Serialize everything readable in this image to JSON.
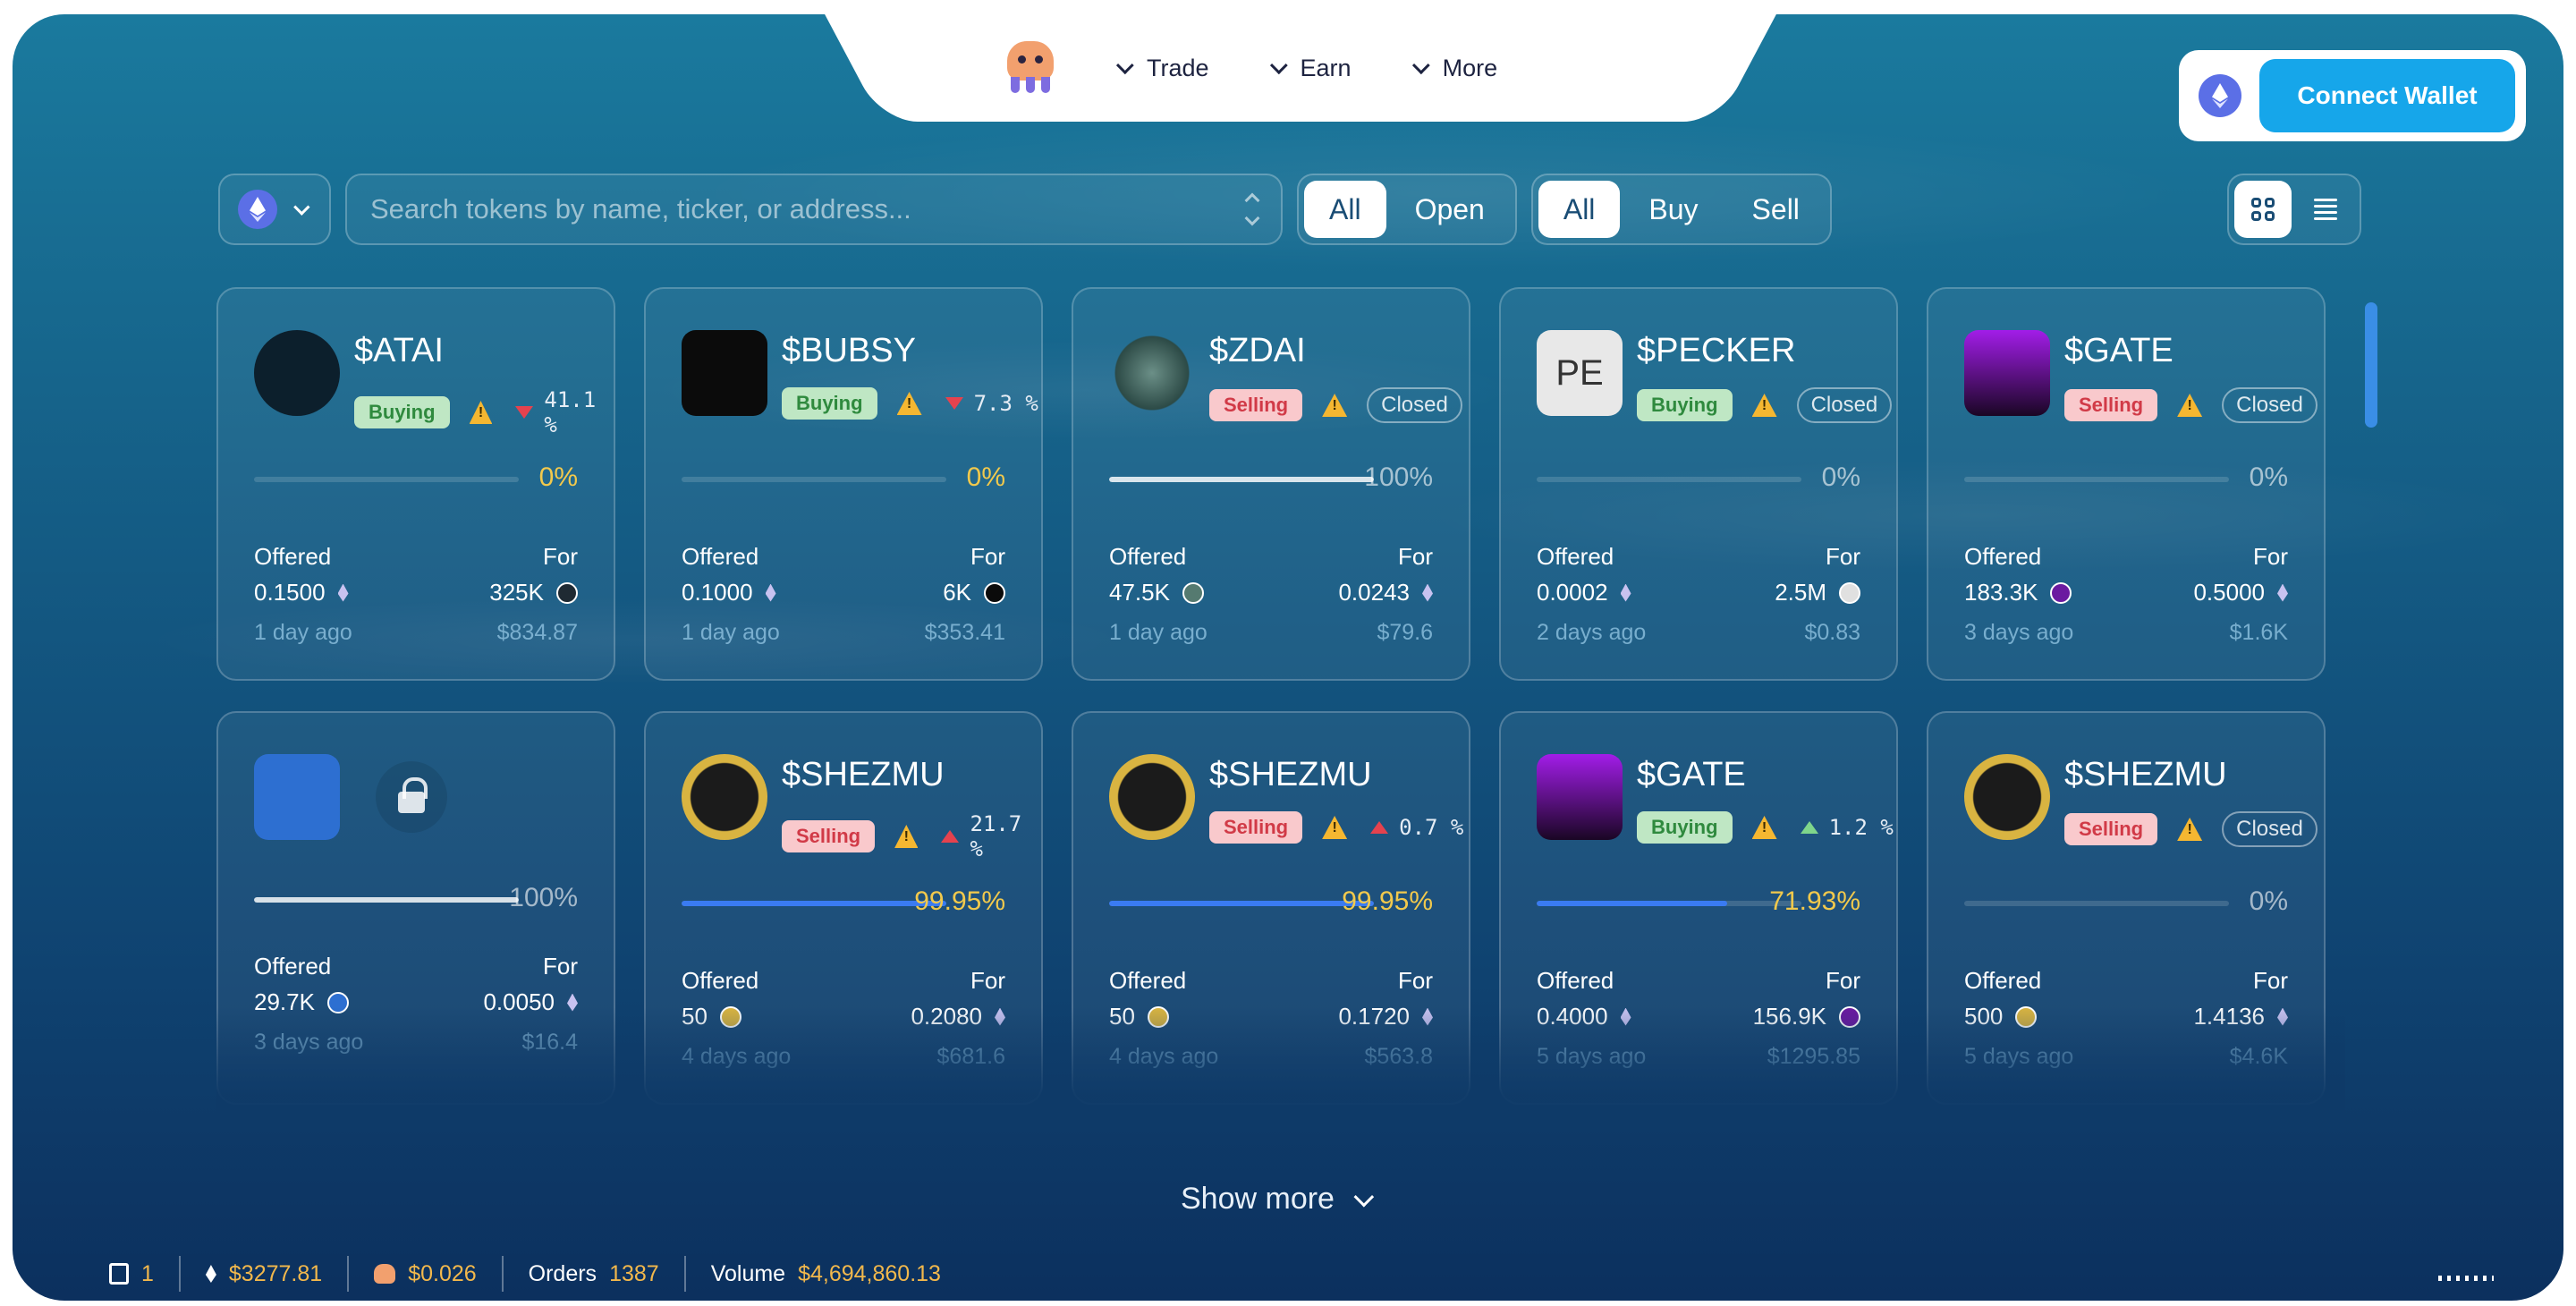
{
  "nav": {
    "items": [
      {
        "label": "Trade"
      },
      {
        "label": "Earn"
      },
      {
        "label": "More"
      }
    ],
    "connect_wallet": "Connect Wallet"
  },
  "filters": {
    "search_placeholder": "Search tokens by name, ticker, or address...",
    "status_options": [
      "All",
      "Open"
    ],
    "status_selected": "All",
    "side_options": [
      "All",
      "Buy",
      "Sell"
    ],
    "side_selected": "All",
    "view_selected": "grid"
  },
  "cards": [
    {
      "ticker": "$ATAI",
      "type": "Buying",
      "change": "41.1 %",
      "direction": "down",
      "closed": "",
      "progress_pct": 0,
      "progress_label": "0%",
      "offered_label": "Offered",
      "for_label": "For",
      "offered": "0.1500",
      "for": "325K",
      "time": "1 day ago",
      "value": "$834.87"
    },
    {
      "ticker": "$BUBSY",
      "type": "Buying",
      "change": "7.3 %",
      "direction": "down",
      "closed": "",
      "progress_pct": 0,
      "progress_label": "0%",
      "offered_label": "Offered",
      "for_label": "For",
      "offered": "0.1000",
      "for": "6K",
      "time": "1 day ago",
      "value": "$353.41"
    },
    {
      "ticker": "$ZDAI",
      "type": "Selling",
      "change": "",
      "direction": "",
      "closed": "Closed",
      "progress_pct": 100,
      "progress_label": "100%",
      "offered_label": "Offered",
      "for_label": "For",
      "offered": "47.5K",
      "for": "0.0243",
      "time": "1 day ago",
      "value": "$79.6"
    },
    {
      "ticker": "$PECKER",
      "type": "Buying",
      "change": "",
      "direction": "",
      "closed": "Closed",
      "progress_pct": 0,
      "progress_label": "0%",
      "offered_label": "Offered",
      "for_label": "For",
      "offered": "0.0002",
      "for": "2.5M",
      "time": "2 days ago",
      "value": "$0.83",
      "icon_text": "PE"
    },
    {
      "ticker": "$GATE",
      "type": "Selling",
      "change": "",
      "direction": "",
      "closed": "Closed",
      "progress_pct": 0,
      "progress_label": "0%",
      "offered_label": "Offered",
      "for_label": "For",
      "offered": "183.3K",
      "for": "0.5000",
      "time": "3 days ago",
      "value": "$1.6K"
    },
    {
      "ticker": "",
      "type": "",
      "change": "",
      "direction": "",
      "closed": "",
      "locked": true,
      "progress_pct": 100,
      "progress_label": "100%",
      "offered_label": "Offered",
      "for_label": "For",
      "offered": "29.7K",
      "for": "0.0050",
      "time": "3 days ago",
      "value": "$16.4"
    },
    {
      "ticker": "$SHEZMU",
      "type": "Selling",
      "change": "21.7 %",
      "direction": "up",
      "closed": "",
      "progress_pct": 99.95,
      "progress_label": "99.95%",
      "offered_label": "Offered",
      "for_label": "For",
      "offered": "50",
      "for": "0.2080",
      "time": "4 days ago",
      "value": "$681.6"
    },
    {
      "ticker": "$SHEZMU",
      "type": "Selling",
      "change": "0.7 %",
      "direction": "up",
      "closed": "",
      "progress_pct": 99.95,
      "progress_label": "99.95%",
      "offered_label": "Offered",
      "for_label": "For",
      "offered": "50",
      "for": "0.1720",
      "time": "4 days ago",
      "value": "$563.8"
    },
    {
      "ticker": "$GATE",
      "type": "Buying",
      "change": "1.2 %",
      "direction": "up-green",
      "closed": "",
      "progress_pct": 71.93,
      "progress_label": "71.93%",
      "offered_label": "Offered",
      "for_label": "For",
      "offered": "0.4000",
      "for": "156.9K",
      "time": "5 days ago",
      "value": "$1295.85"
    },
    {
      "ticker": "$SHEZMU",
      "type": "Selling",
      "change": "",
      "direction": "",
      "closed": "Closed",
      "progress_pct": 0,
      "progress_label": "0%",
      "offered_label": "Offered",
      "for_label": "For",
      "offered": "500",
      "for": "1.4136",
      "time": "5 days ago",
      "value": "$4.6K"
    }
  ],
  "show_more": "Show more",
  "status_bar": {
    "gas": "1",
    "eth_price": "$3277.81",
    "token_price": "$0.026",
    "orders_label": "Orders",
    "orders": "1387",
    "volume_label": "Volume",
    "volume": "$4,694,860.13"
  },
  "colors": {
    "accent": "#16a6ea",
    "buy": "#2f8a3e",
    "sell": "#d13a47",
    "highlight": "#f2c94c",
    "progress": "#3a7bf2"
  }
}
